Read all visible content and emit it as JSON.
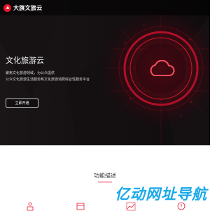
{
  "brand": {
    "name": "大旗文旅云",
    "color": "#e8162b"
  },
  "hero": {
    "title": "文化旅游云",
    "desc_line1": "聚焦文化旅游领域，为公众提供",
    "desc_line2": "公众文化旅游生活服务和文化旅游消费综合性服务平台",
    "button_label": "立即开通",
    "background_color": "#0f0c0e",
    "accent_color": "#e8162b",
    "visual_icon": "cloud-icon"
  },
  "features": {
    "title": "功能描述",
    "icons": [
      "feature-icon-1",
      "feature-icon-2",
      "feature-icon-3",
      "feature-icon-4"
    ]
  },
  "watermark": {
    "text": "亿动网址导航",
    "color": "#1aa9e8"
  }
}
